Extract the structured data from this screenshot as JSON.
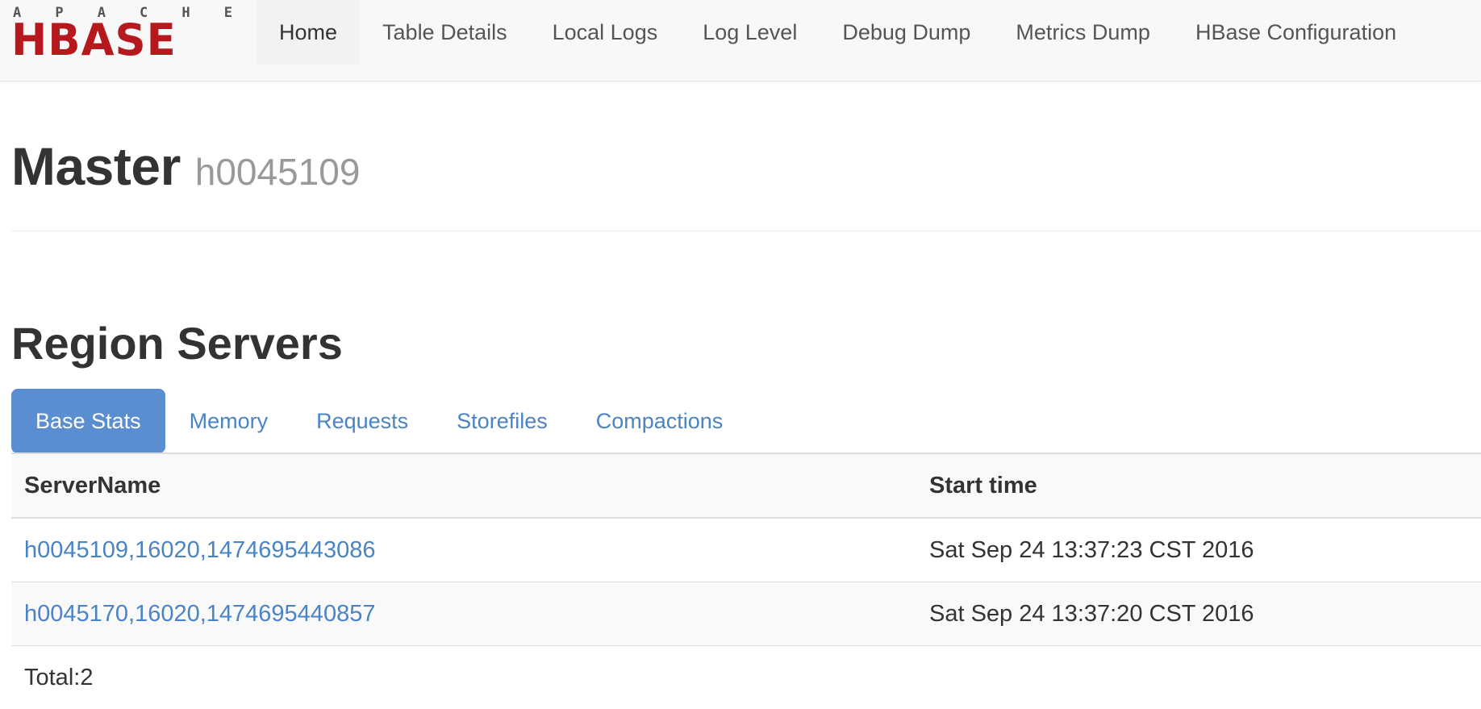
{
  "brand": {
    "line1": "APACHE",
    "line2": "HBASE"
  },
  "nav": {
    "items": [
      {
        "label": "Home",
        "active": true
      },
      {
        "label": "Table Details"
      },
      {
        "label": "Local Logs"
      },
      {
        "label": "Log Level"
      },
      {
        "label": "Debug Dump"
      },
      {
        "label": "Metrics Dump"
      },
      {
        "label": "HBase Configuration"
      }
    ]
  },
  "header": {
    "title": "Master",
    "subtitle": "h0045109"
  },
  "region_servers": {
    "title": "Region Servers",
    "tabs": [
      {
        "label": "Base Stats",
        "active": true
      },
      {
        "label": "Memory"
      },
      {
        "label": "Requests"
      },
      {
        "label": "Storefiles"
      },
      {
        "label": "Compactions"
      }
    ],
    "table": {
      "headers": [
        "ServerName",
        "Start time"
      ],
      "rows": [
        {
          "server": "h0045109,16020,1474695443086",
          "start_time": "Sat Sep 24 13:37:23 CST 2016"
        },
        {
          "server": "h0045170,16020,1474695440857",
          "start_time": "Sat Sep 24 13:37:20 CST 2016"
        }
      ],
      "total": "Total:2"
    }
  },
  "colors": {
    "brand_red": "#b5181d",
    "link": "#4a84c4",
    "active_tab": "#5a8ed1"
  }
}
